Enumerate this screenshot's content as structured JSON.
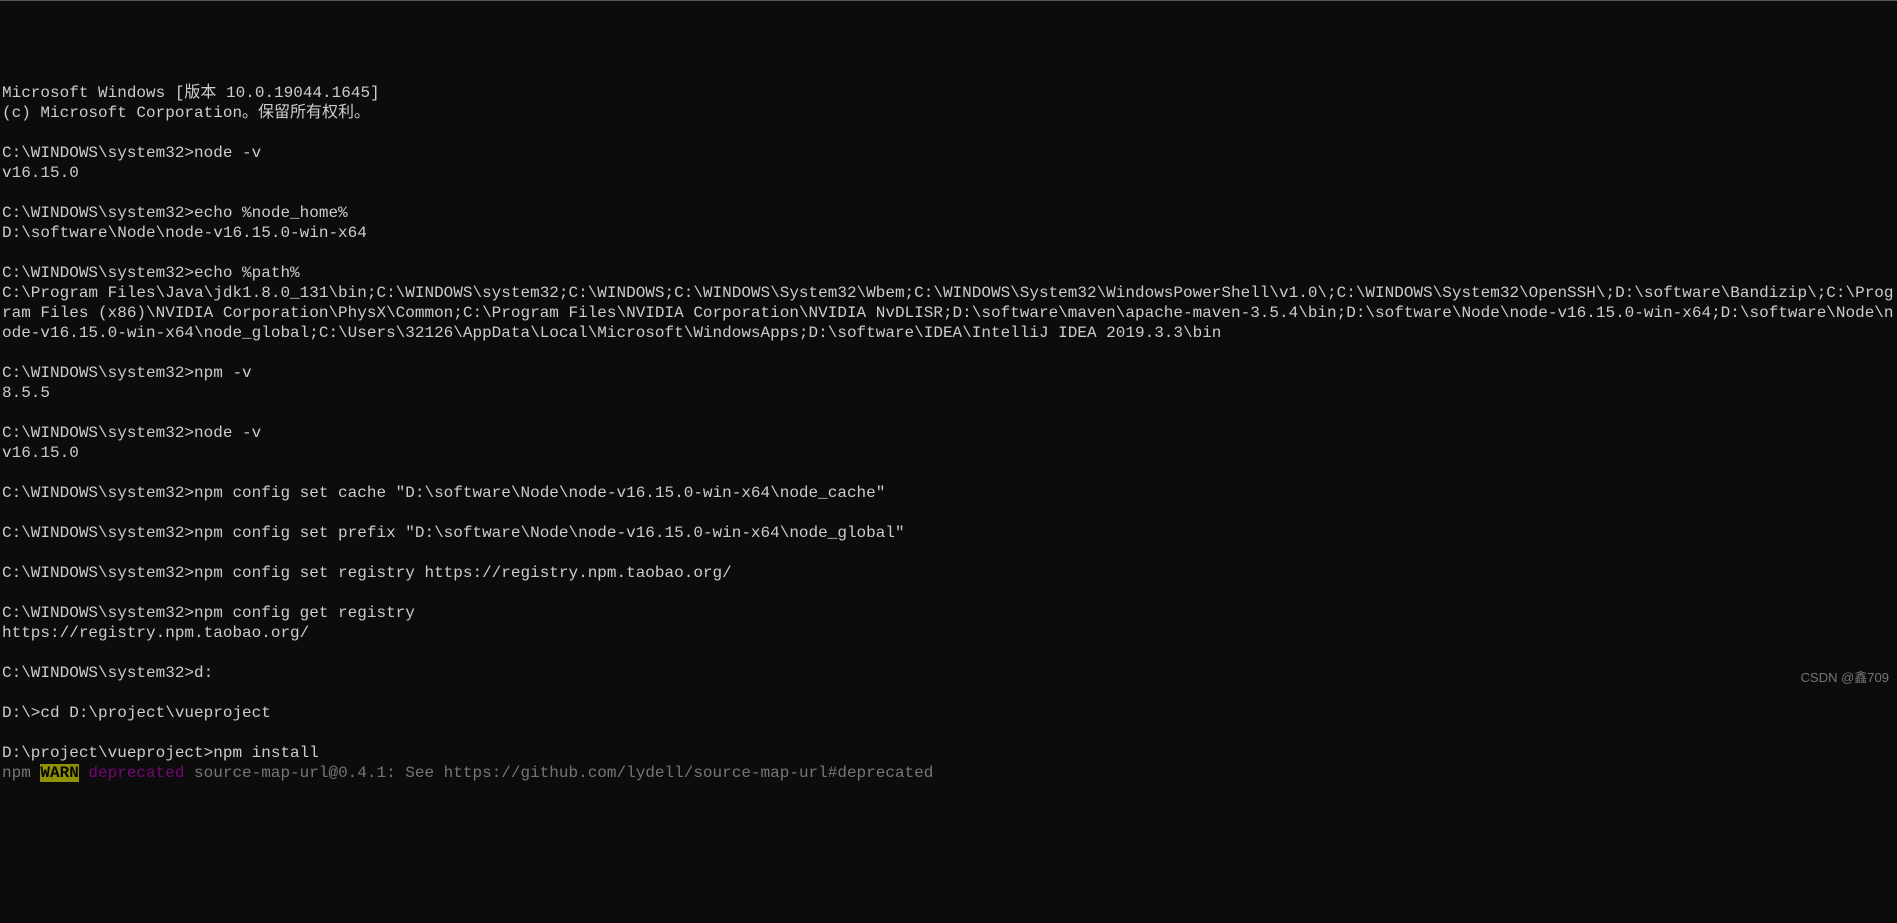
{
  "header": {
    "line1": "Microsoft Windows [版本 10.0.19044.1645]",
    "line2": "(c) Microsoft Corporation。保留所有权利。"
  },
  "blocks": [
    {
      "prompt": "C:\\WINDOWS\\system32>",
      "cmd": "node -v",
      "out": [
        "v16.15.0"
      ]
    },
    {
      "prompt": "C:\\WINDOWS\\system32>",
      "cmd": "echo %node_home%",
      "out": [
        "D:\\software\\Node\\node-v16.15.0-win-x64"
      ]
    },
    {
      "prompt": "C:\\WINDOWS\\system32>",
      "cmd": "echo %path%",
      "out": [
        "C:\\Program Files\\Java\\jdk1.8.0_131\\bin;C:\\WINDOWS\\system32;C:\\WINDOWS;C:\\WINDOWS\\System32\\Wbem;C:\\WINDOWS\\System32\\WindowsPowerShell\\v1.0\\;C:\\WINDOWS\\System32\\OpenSSH\\;D:\\software\\Bandizip\\;C:\\Program Files (x86)\\NVIDIA Corporation\\PhysX\\Common;C:\\Program Files\\NVIDIA Corporation\\NVIDIA NvDLISR;D:\\software\\maven\\apache-maven-3.5.4\\bin;D:\\software\\Node\\node-v16.15.0-win-x64;D:\\software\\Node\\node-v16.15.0-win-x64\\node_global;C:\\Users\\32126\\AppData\\Local\\Microsoft\\WindowsApps;D:\\software\\IDEA\\IntelliJ IDEA 2019.3.3\\bin"
      ]
    },
    {
      "prompt": "C:\\WINDOWS\\system32>",
      "cmd": "npm -v",
      "out": [
        "8.5.5"
      ]
    },
    {
      "prompt": "C:\\WINDOWS\\system32>",
      "cmd": "node -v",
      "out": [
        "v16.15.0"
      ]
    },
    {
      "prompt": "C:\\WINDOWS\\system32>",
      "cmd": "npm config set cache \"D:\\software\\Node\\node-v16.15.0-win-x64\\node_cache\"",
      "out": []
    },
    {
      "prompt": "C:\\WINDOWS\\system32>",
      "cmd": "npm config set prefix \"D:\\software\\Node\\node-v16.15.0-win-x64\\node_global\"",
      "out": []
    },
    {
      "prompt": "C:\\WINDOWS\\system32>",
      "cmd": "npm config set registry https://registry.npm.taobao.org/",
      "out": []
    },
    {
      "prompt": "C:\\WINDOWS\\system32>",
      "cmd": "npm config get registry",
      "out": [
        "https://registry.npm.taobao.org/"
      ]
    },
    {
      "prompt": "C:\\WINDOWS\\system32>",
      "cmd": "d:",
      "out": []
    },
    {
      "prompt": "D:\\>",
      "cmd": "cd D:\\project\\vueproject",
      "out": []
    },
    {
      "prompt": "D:\\project\\vueproject>",
      "cmd": "npm install",
      "out": []
    }
  ],
  "warn": {
    "npm": "npm ",
    "warn_label": "WARN",
    "deprecated": " deprecated",
    "rest": " source-map-url@0.4.1: See https://github.com/lydell/source-map-url#deprecated"
  },
  "watermark": "CSDN @鑫709"
}
